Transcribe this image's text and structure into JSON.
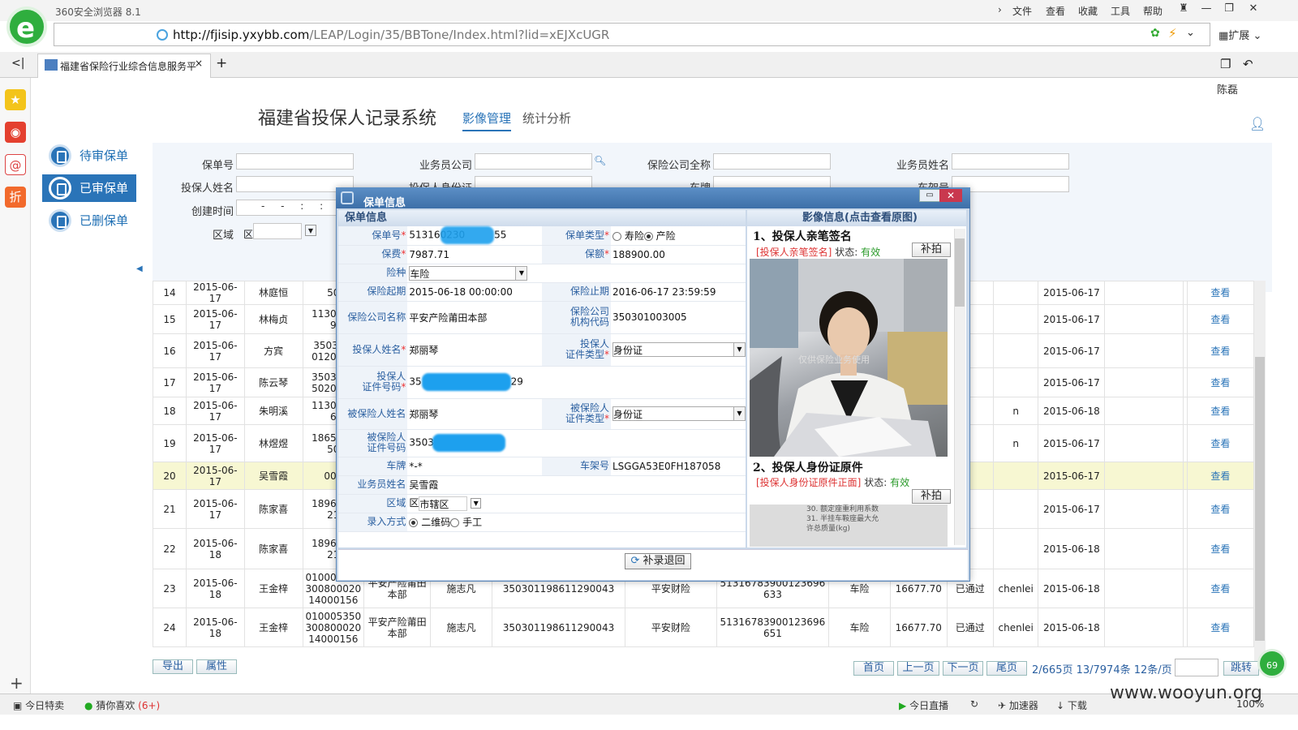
{
  "browser": {
    "title": "360安全浏览器 8.1",
    "menus": [
      "文件",
      "查看",
      "收藏",
      "工具",
      "帮助"
    ],
    "url_host": "http://fjisip.yxybb.com",
    "url_path": "/LEAP/Login/35/BBTone/Index.html?lid=xEJXcUGR",
    "ext_label": "扩展",
    "tab_title": "福建省保险行业综合信息服务平",
    "user": "陈磊",
    "status_left": [
      "今日特卖",
      "猜你喜欢"
    ],
    "status_badge": "(6+)",
    "status_right": [
      "今日直播",
      "加速器",
      "下载"
    ],
    "zoom": "100%",
    "watermark": "www.wooyun.org",
    "float_badge": "69"
  },
  "app": {
    "system_title": "福建省投保人记录系统",
    "tabs": [
      "影像管理",
      "统计分析"
    ],
    "nav": [
      "待审保单",
      "已审保单",
      "已删保单"
    ]
  },
  "search": {
    "labels": [
      "保单号",
      "业务员公司",
      "保险公司全称",
      "业务员姓名",
      "投保人姓名",
      "投保人身份证",
      "车牌",
      "车架号",
      "创建时间",
      "区域"
    ],
    "region_prefix": "区",
    "date_mask": "- - : :"
  },
  "table": {
    "rows": [
      {
        "no": "14",
        "date": "2015-06-17",
        "name": "林庭恒",
        "policy": "50",
        "c4": "",
        "c5": "",
        "c6": "",
        "c7": "",
        "c8": "",
        "c9": "",
        "c10": "",
        "c11": "",
        "c12": "",
        "date2": "2015-06-17",
        "op": "查看"
      },
      {
        "no": "15",
        "date": "2015-06-17",
        "name": "林梅贞",
        "policy": "1130566\n9",
        "c4": "",
        "c5": "",
        "c6": "",
        "c7": "",
        "c8": "",
        "c9": "",
        "c10": "",
        "c11": "",
        "c12": "",
        "date2": "2015-06-17",
        "op": "查看"
      },
      {
        "no": "16",
        "date": "2015-06-17",
        "name": "方宾",
        "policy": "350303l\n0120500",
        "c4": "",
        "c5": "",
        "c6": "",
        "c7": "",
        "c8": "",
        "c9": "",
        "c10": "",
        "c11": "",
        "c12": "",
        "date2": "2015-06-17",
        "op": "查看"
      },
      {
        "no": "17",
        "date": "2015-06-17",
        "name": "陈云琴",
        "policy": "3503021\n5020503",
        "c4": "",
        "c5": "",
        "c6": "",
        "c7": "",
        "c8": "",
        "c9": "",
        "c10": "",
        "c11": "",
        "c12": "",
        "date2": "2015-06-17",
        "op": "查看"
      },
      {
        "no": "18",
        "date": "2015-06-17",
        "name": "朱明溪",
        "policy": "1130158\n6",
        "c4": "",
        "c5": "",
        "c6": "",
        "c7": "",
        "c8": "",
        "c9": "",
        "c10": "",
        "c11": "",
        "c12": "n",
        "date2": "2015-06-18",
        "op": "查看"
      },
      {
        "no": "19",
        "date": "2015-06-17",
        "name": "林煜煜",
        "policy": "1865024\n50",
        "c4": "",
        "c5": "",
        "c6": "",
        "c7": "",
        "c8": "",
        "c9": "",
        "c10": "",
        "c11": "",
        "c12": "n",
        "date2": "2015-06-17",
        "op": "查看"
      },
      {
        "no": "20",
        "date": "2015-06-17",
        "name": "吴雪霞",
        "policy": "001",
        "c4": "",
        "c5": "",
        "c6": "",
        "c7": "",
        "c8": "",
        "c9": "",
        "c10": "",
        "c11": "",
        "c12": "",
        "date2": "2015-06-17",
        "op": "查看"
      },
      {
        "no": "21",
        "date": "2015-06-17",
        "name": "陈家喜",
        "policy": "1896589\n21",
        "c4": "",
        "c5": "",
        "c6": "",
        "c7": "",
        "c8": "",
        "c9": "",
        "c10": "",
        "c11": "",
        "c12": "",
        "date2": "2015-06-17",
        "op": "查看"
      },
      {
        "no": "22",
        "date": "2015-06-18",
        "name": "陈家喜",
        "policy": "1896589\n21",
        "c4": "",
        "c5": "",
        "c6": "",
        "c7": "",
        "c8": "",
        "c9": "",
        "c10": "",
        "c11": "",
        "c12": "",
        "date2": "2015-06-18",
        "op": "查看"
      },
      {
        "no": "23",
        "date": "2015-06-18",
        "name": "王金梓",
        "policy": "010005350\n300800020\n14000156",
        "c4": "平安产险莆田\n本部",
        "c5": "施志凡",
        "c6": "350301198611290043",
        "c7": "平安财险",
        "c8": "51316783900123696\n633",
        "c9": "车险",
        "c10": "16677.70",
        "c11": "已通过",
        "c12": "chenlei",
        "date2": "2015-06-18",
        "op": "查看"
      },
      {
        "no": "24",
        "date": "2015-06-18",
        "name": "王金梓",
        "policy": "010005350\n300800020\n14000156",
        "c4": "平安产险莆田\n本部",
        "c5": "施志凡",
        "c6": "350301198611290043",
        "c7": "平安财险",
        "c8": "51316783900123696\n651",
        "c9": "车险",
        "c10": "16677.70",
        "c11": "已通过",
        "c12": "chenlei",
        "date2": "2015-06-18",
        "op": "查看"
      }
    ],
    "selected_index": 6
  },
  "pager": {
    "export": "导出",
    "props": "属性",
    "first": "首页",
    "prev": "上一页",
    "next": "下一页",
    "last": "尾页",
    "info": "2/665页 13/7974条 12条/页",
    "jump": "跳转"
  },
  "dialog": {
    "title": "保单信息",
    "left_header": "保单信息",
    "right_header": "影像信息(点击查看原图)",
    "fields": {
      "policy_no_label": "保单号",
      "policy_no_prefix": "513160230",
      "policy_no_suffix": "55",
      "policy_type_label": "保单类型",
      "policy_type_opt1": "寿险",
      "policy_type_opt2": "产险",
      "premium_label": "保费",
      "premium": "7987.71",
      "insured_amount_label": "保额",
      "insured_amount": "188900.00",
      "risk_label": "险种",
      "risk": "车险",
      "start_label": "保险起期",
      "start": "2015-06-18 00:00:00",
      "end_label": "保险止期",
      "end": "2016-06-17 23:59:59",
      "company_label": "保险公司名称",
      "company": "平安产险莆田本部",
      "org_code_label_1": "保险公司",
      "org_code_label_2": "机构代码",
      "org_code": "350301003005",
      "applicant_label": "投保人姓名",
      "applicant": "郑丽琴",
      "applicant_id_type_label_1": "投保人",
      "applicant_id_type_label_2": "证件类型",
      "applicant_id_type": "身份证",
      "applicant_id_label_1": "投保人",
      "applicant_id_label_2": "证件号码",
      "applicant_id_prefix": "35",
      "applicant_id_suffix": "29",
      "insured_label": "被保险人姓名",
      "insured": "郑丽琴",
      "insured_id_type_label_1": "被保险人",
      "insured_id_type_label_2": "证件类型",
      "insured_id_type": "身份证",
      "insured_id_label_1": "被保险人",
      "insured_id_label_2": "证件号码",
      "insured_id_prefix": "35030",
      "plate_label": "车牌",
      "plate": "*-*",
      "vin_label": "车架号",
      "vin": "LSGGA53E0FH187058",
      "agent_label": "业务员姓名",
      "agent": "吴雪霞",
      "area_label": "区域",
      "area_prefix": "区",
      "area": "市辖区",
      "input_mode_label": "录入方式",
      "input_mode_opt1": "二维码",
      "input_mode_opt2": "手工"
    },
    "images": [
      {
        "title": "1、投保人亲笔签名",
        "link": "[投保人亲笔签名]",
        "status_label": "状态:",
        "status": "有效",
        "button": "补拍",
        "overlay": "仅供保险业务使用"
      },
      {
        "title": "2、投保人身份证原件",
        "link": "[投保人身份证原件正面]",
        "status_label": "状态:",
        "status": "有效",
        "button": "补拍"
      }
    ],
    "doc_lines": [
      "30. 额定座重利用系数",
      "31. 半挂车鞍座最大允",
      "许总质量(kg)"
    ],
    "reject_button": "补录退回"
  },
  "colors": {
    "accent": "#2a74b8",
    "selected_row": "#f7f7d2",
    "dialog_head": "#3d6fa8"
  }
}
